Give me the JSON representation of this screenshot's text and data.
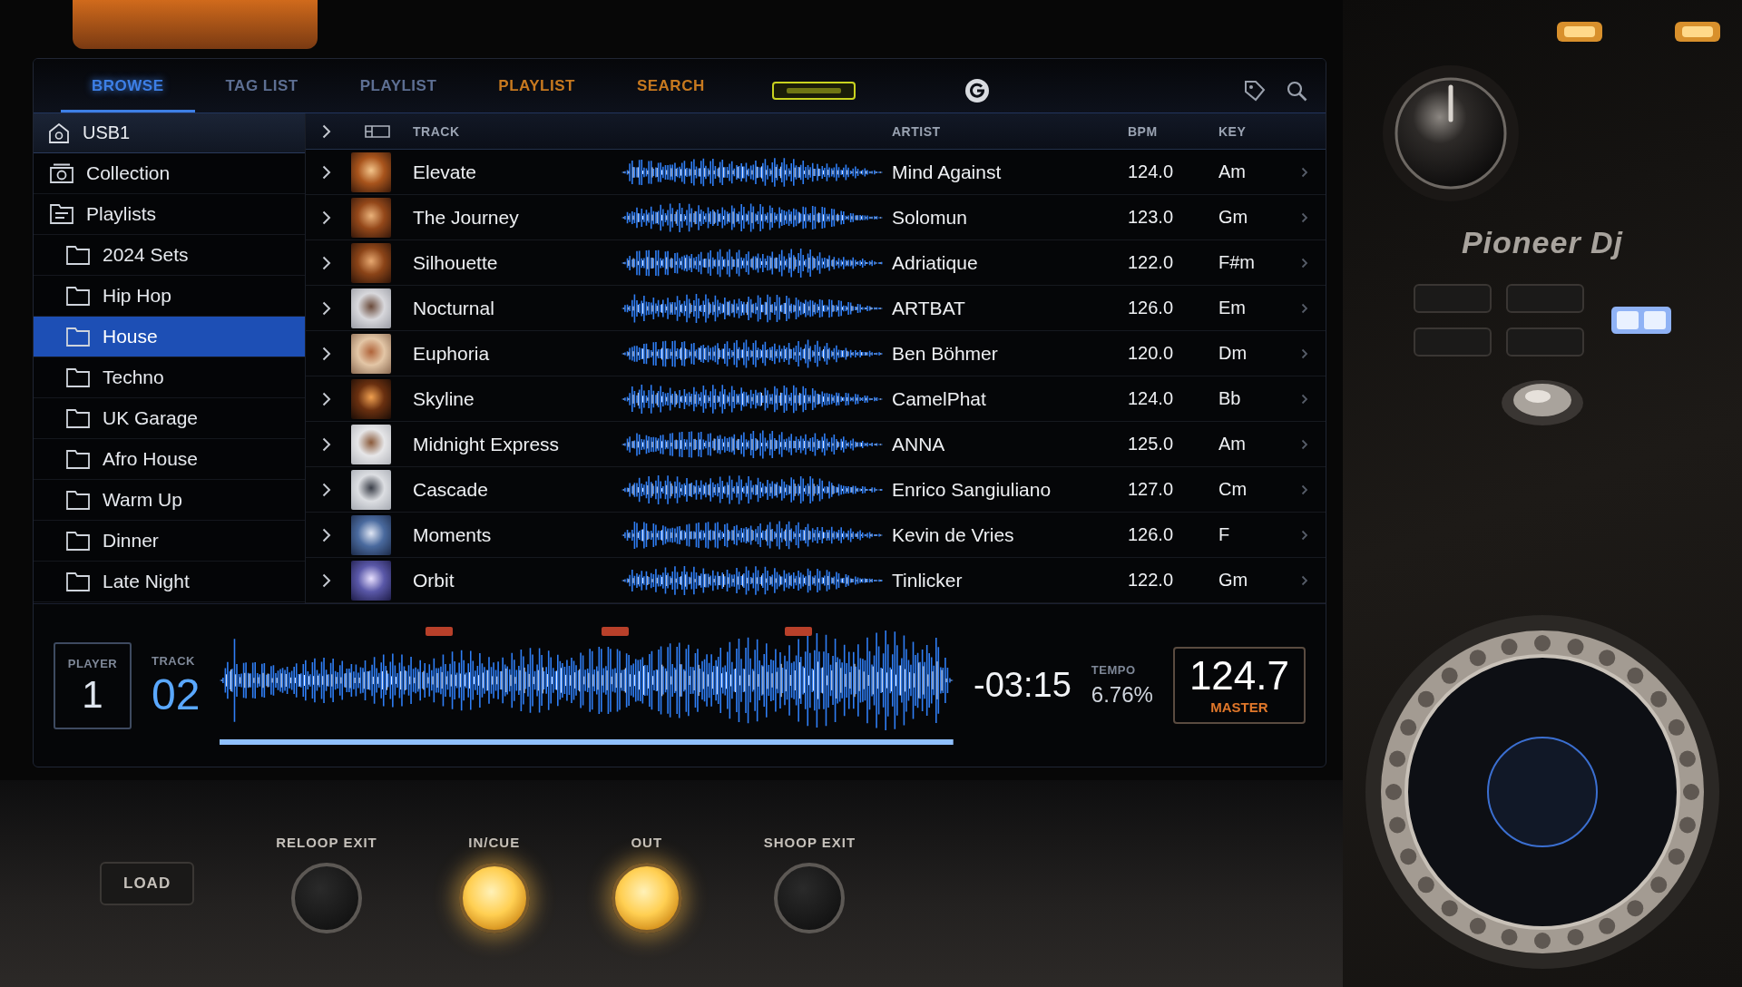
{
  "tabs": [
    {
      "label": "BROWSE",
      "selected": true,
      "color": "#3d7fe6"
    },
    {
      "label": "TAG LIST",
      "selected": false,
      "color": "#5d6f93"
    },
    {
      "label": "PLAYLIST",
      "selected": false,
      "color": "#5d6f93"
    },
    {
      "label": "PLAYLIST",
      "selected": false,
      "color": "#c7791f"
    },
    {
      "label": "SEARCH",
      "selected": false,
      "color": "#c7791f"
    }
  ],
  "sidebar": {
    "title": "USB1",
    "items": [
      {
        "label": "Collection",
        "kind": "collection",
        "selected": false
      },
      {
        "label": "Playlists",
        "kind": "playlists",
        "selected": false,
        "children": [
          {
            "label": "2024 Sets",
            "kind": "folder",
            "selected": false
          },
          {
            "label": "Hip Hop",
            "kind": "folder",
            "selected": false
          },
          {
            "label": "House",
            "kind": "folder",
            "selected": true
          },
          {
            "label": "Techno",
            "kind": "folder",
            "selected": false
          },
          {
            "label": "UK Garage",
            "kind": "folder",
            "selected": false
          },
          {
            "label": "Afro House",
            "kind": "folder",
            "selected": false
          },
          {
            "label": "Warm Up",
            "kind": "folder",
            "selected": false
          },
          {
            "label": "Dinner",
            "kind": "folder",
            "selected": false
          },
          {
            "label": "Late Night",
            "kind": "folder",
            "selected": false
          }
        ]
      }
    ]
  },
  "tracklist": {
    "columns": [
      "TRACK",
      "ARTIST",
      "BPM",
      "KEY"
    ],
    "rows": [
      {
        "track": "Elevate",
        "artist": "Mind Against",
        "bpm": "124.0",
        "key": "Am"
      },
      {
        "track": "The Journey",
        "artist": "Solomun",
        "bpm": "123.0",
        "key": "Gm"
      },
      {
        "track": "Silhouette",
        "artist": "Adriatique",
        "bpm": "122.0",
        "key": "F#m"
      },
      {
        "track": "Nocturnal",
        "artist": "ARTBAT",
        "bpm": "126.0",
        "key": "Em"
      },
      {
        "track": "Euphoria",
        "artist": "Ben Böhmer",
        "bpm": "120.0",
        "key": "Dm"
      },
      {
        "track": "Skyline",
        "artist": "CamelPhat",
        "bpm": "124.0",
        "key": "Bb"
      },
      {
        "track": "Midnight Express",
        "artist": "ANNA",
        "bpm": "125.0",
        "key": "Am"
      },
      {
        "track": "Cascade",
        "artist": "Enrico Sangiuliano",
        "bpm": "127.0",
        "key": "Cm"
      },
      {
        "track": "Moments",
        "artist": "Kevin de Vries",
        "bpm": "126.0",
        "key": "F"
      },
      {
        "track": "Orbit",
        "artist": "Tinlicker",
        "bpm": "122.0",
        "key": "Gm"
      }
    ]
  },
  "deck": {
    "player_label": "PLAYER",
    "player": "1",
    "track_label": "TRACK",
    "track": "02",
    "time": "-03:15",
    "tempo_label": "TEMPO",
    "tempo": "6.76%",
    "master_bpm": "124.7",
    "master_label": "MASTER"
  },
  "hardware": {
    "logo": "Pioneer Dj",
    "buttons": [
      {
        "label": "LOAD",
        "kind": "pad",
        "lit": false
      },
      {
        "label": "RELOOP EXIT",
        "kind": "round",
        "lit": false
      },
      {
        "label": "IN/CUE",
        "kind": "round",
        "lit": true
      },
      {
        "label": "OUT",
        "kind": "round",
        "lit": true
      },
      {
        "label": "SHOOP EXIT",
        "kind": "round",
        "lit": false
      }
    ]
  }
}
